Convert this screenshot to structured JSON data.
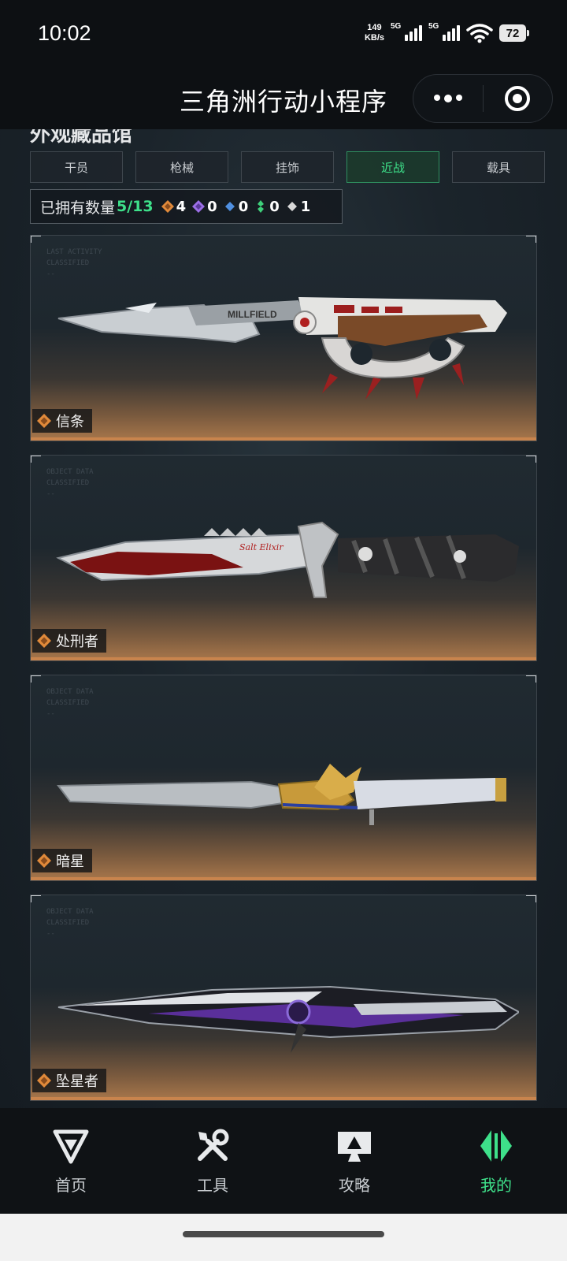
{
  "status_bar": {
    "time": "10:02",
    "net_speed_value": "149",
    "net_speed_unit": "KB/s",
    "sim1": "5G",
    "sim2": "5G",
    "battery": "72"
  },
  "title_bar": {
    "title": "三角洲行动小程序",
    "more_icon": "more-dots-icon",
    "close_icon": "target-circle-icon"
  },
  "collection": {
    "section_title": "外观藏品馆",
    "tabs": [
      {
        "label": "干员",
        "active": false
      },
      {
        "label": "枪械",
        "active": false
      },
      {
        "label": "挂饰",
        "active": false
      },
      {
        "label": "近战",
        "active": true
      },
      {
        "label": "载具",
        "active": false
      }
    ],
    "owned_label": "已拥有数量",
    "owned_value": "5/13",
    "rarity_counts": [
      {
        "icon": "orange-gem-icon",
        "color": "#e0893a",
        "count": "4"
      },
      {
        "icon": "purple-gem-icon",
        "color": "#9b6ee6",
        "count": "0"
      },
      {
        "icon": "blue-gem-icon",
        "color": "#4f8fe0",
        "count": "0"
      },
      {
        "icon": "green-gem-icon",
        "color": "#3ecf7a",
        "count": "0"
      },
      {
        "icon": "white-gem-icon",
        "color": "#d8d8d8",
        "count": "1"
      }
    ],
    "items": [
      {
        "name": "信条",
        "rarity_icon": "orange-gem-icon"
      },
      {
        "name": "处刑者",
        "rarity_icon": "orange-gem-icon"
      },
      {
        "name": "暗星",
        "rarity_icon": "orange-gem-icon"
      },
      {
        "name": "坠星者",
        "rarity_icon": "orange-gem-icon"
      }
    ]
  },
  "bottom_nav": [
    {
      "label": "首页",
      "icon": "home-logo-icon",
      "active": false
    },
    {
      "label": "工具",
      "icon": "tools-icon",
      "active": false
    },
    {
      "label": "攻略",
      "icon": "guide-monitor-icon",
      "active": false
    },
    {
      "label": "我的",
      "icon": "profile-logo-icon",
      "active": true
    }
  ],
  "colors": {
    "accent": "#3ee08a",
    "orange_rarity": "#e0893a"
  }
}
